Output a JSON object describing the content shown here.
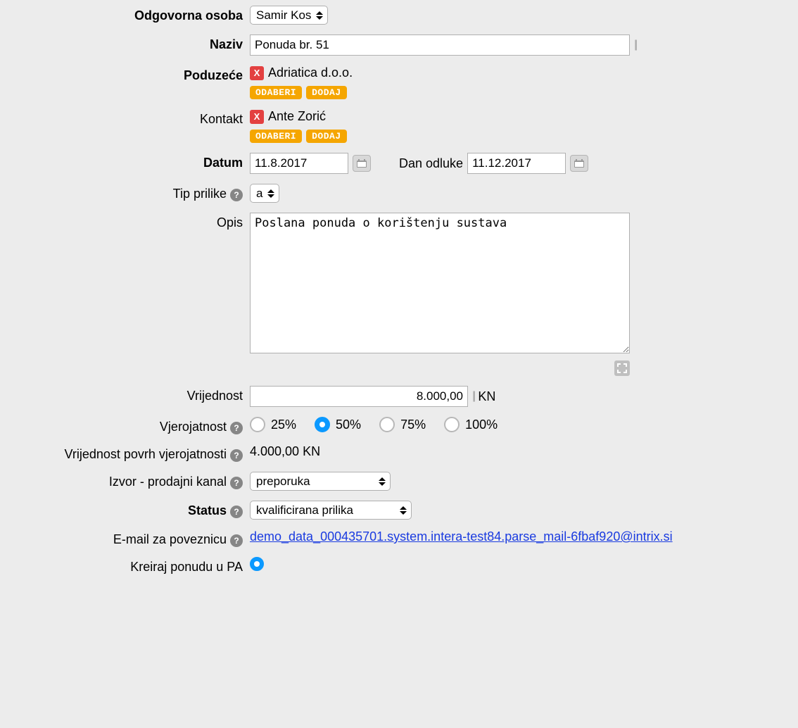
{
  "labels": {
    "responsible": "Odgovorna osoba",
    "name": "Naziv",
    "company": "Poduzeće",
    "contact": "Kontakt",
    "date": "Datum",
    "decision_day": "Dan odluke",
    "opportunity_type": "Tip prilike",
    "description": "Opis",
    "value": "Vrijednost",
    "probability": "Vjerojatnost",
    "value_over_prob": "Vrijednost povrh vjerojatnosti",
    "source": "Izvor - prodajni kanal",
    "status": "Status",
    "email_link": "E-mail za poveznicu",
    "create_pa": "Kreiraj ponudu u PA"
  },
  "buttons": {
    "odaberi": "ODABERI",
    "dodaj": "DODAJ",
    "x": "X"
  },
  "values": {
    "responsible": "Samir Kos",
    "name": "Ponuda br. 51",
    "company": "Adriatica d.o.o.",
    "contact": "Ante Zorić",
    "date": "11.8.2017",
    "decision_day": "11.12.2017",
    "opportunity_type": "a",
    "description": "Poslana ponuda o korištenju sustava",
    "value": "8.000,00",
    "currency": "KN",
    "value_over_prob": "4.000,00 KN",
    "source": "preporuka",
    "status": "kvalificirana prilika",
    "email": "demo_data_000435701.system.intera-test84.parse_mail-6fbaf920@intrix.si"
  },
  "probability": {
    "options": [
      "25%",
      "50%",
      "75%",
      "100%"
    ],
    "selected": "50%"
  }
}
